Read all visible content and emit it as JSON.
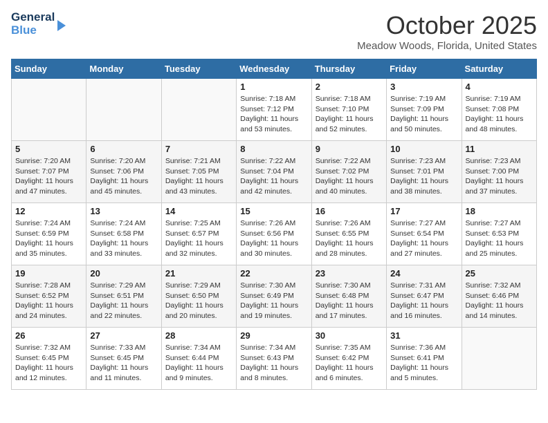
{
  "logo": {
    "line1": "General",
    "line2": "Blue"
  },
  "title": "October 2025",
  "location": "Meadow Woods, Florida, United States",
  "days_of_week": [
    "Sunday",
    "Monday",
    "Tuesday",
    "Wednesday",
    "Thursday",
    "Friday",
    "Saturday"
  ],
  "weeks": [
    [
      {
        "day": "",
        "info": ""
      },
      {
        "day": "",
        "info": ""
      },
      {
        "day": "",
        "info": ""
      },
      {
        "day": "1",
        "info": "Sunrise: 7:18 AM\nSunset: 7:12 PM\nDaylight: 11 hours\nand 53 minutes."
      },
      {
        "day": "2",
        "info": "Sunrise: 7:18 AM\nSunset: 7:10 PM\nDaylight: 11 hours\nand 52 minutes."
      },
      {
        "day": "3",
        "info": "Sunrise: 7:19 AM\nSunset: 7:09 PM\nDaylight: 11 hours\nand 50 minutes."
      },
      {
        "day": "4",
        "info": "Sunrise: 7:19 AM\nSunset: 7:08 PM\nDaylight: 11 hours\nand 48 minutes."
      }
    ],
    [
      {
        "day": "5",
        "info": "Sunrise: 7:20 AM\nSunset: 7:07 PM\nDaylight: 11 hours\nand 47 minutes."
      },
      {
        "day": "6",
        "info": "Sunrise: 7:20 AM\nSunset: 7:06 PM\nDaylight: 11 hours\nand 45 minutes."
      },
      {
        "day": "7",
        "info": "Sunrise: 7:21 AM\nSunset: 7:05 PM\nDaylight: 11 hours\nand 43 minutes."
      },
      {
        "day": "8",
        "info": "Sunrise: 7:22 AM\nSunset: 7:04 PM\nDaylight: 11 hours\nand 42 minutes."
      },
      {
        "day": "9",
        "info": "Sunrise: 7:22 AM\nSunset: 7:02 PM\nDaylight: 11 hours\nand 40 minutes."
      },
      {
        "day": "10",
        "info": "Sunrise: 7:23 AM\nSunset: 7:01 PM\nDaylight: 11 hours\nand 38 minutes."
      },
      {
        "day": "11",
        "info": "Sunrise: 7:23 AM\nSunset: 7:00 PM\nDaylight: 11 hours\nand 37 minutes."
      }
    ],
    [
      {
        "day": "12",
        "info": "Sunrise: 7:24 AM\nSunset: 6:59 PM\nDaylight: 11 hours\nand 35 minutes."
      },
      {
        "day": "13",
        "info": "Sunrise: 7:24 AM\nSunset: 6:58 PM\nDaylight: 11 hours\nand 33 minutes."
      },
      {
        "day": "14",
        "info": "Sunrise: 7:25 AM\nSunset: 6:57 PM\nDaylight: 11 hours\nand 32 minutes."
      },
      {
        "day": "15",
        "info": "Sunrise: 7:26 AM\nSunset: 6:56 PM\nDaylight: 11 hours\nand 30 minutes."
      },
      {
        "day": "16",
        "info": "Sunrise: 7:26 AM\nSunset: 6:55 PM\nDaylight: 11 hours\nand 28 minutes."
      },
      {
        "day": "17",
        "info": "Sunrise: 7:27 AM\nSunset: 6:54 PM\nDaylight: 11 hours\nand 27 minutes."
      },
      {
        "day": "18",
        "info": "Sunrise: 7:27 AM\nSunset: 6:53 PM\nDaylight: 11 hours\nand 25 minutes."
      }
    ],
    [
      {
        "day": "19",
        "info": "Sunrise: 7:28 AM\nSunset: 6:52 PM\nDaylight: 11 hours\nand 24 minutes."
      },
      {
        "day": "20",
        "info": "Sunrise: 7:29 AM\nSunset: 6:51 PM\nDaylight: 11 hours\nand 22 minutes."
      },
      {
        "day": "21",
        "info": "Sunrise: 7:29 AM\nSunset: 6:50 PM\nDaylight: 11 hours\nand 20 minutes."
      },
      {
        "day": "22",
        "info": "Sunrise: 7:30 AM\nSunset: 6:49 PM\nDaylight: 11 hours\nand 19 minutes."
      },
      {
        "day": "23",
        "info": "Sunrise: 7:30 AM\nSunset: 6:48 PM\nDaylight: 11 hours\nand 17 minutes."
      },
      {
        "day": "24",
        "info": "Sunrise: 7:31 AM\nSunset: 6:47 PM\nDaylight: 11 hours\nand 16 minutes."
      },
      {
        "day": "25",
        "info": "Sunrise: 7:32 AM\nSunset: 6:46 PM\nDaylight: 11 hours\nand 14 minutes."
      }
    ],
    [
      {
        "day": "26",
        "info": "Sunrise: 7:32 AM\nSunset: 6:45 PM\nDaylight: 11 hours\nand 12 minutes."
      },
      {
        "day": "27",
        "info": "Sunrise: 7:33 AM\nSunset: 6:45 PM\nDaylight: 11 hours\nand 11 minutes."
      },
      {
        "day": "28",
        "info": "Sunrise: 7:34 AM\nSunset: 6:44 PM\nDaylight: 11 hours\nand 9 minutes."
      },
      {
        "day": "29",
        "info": "Sunrise: 7:34 AM\nSunset: 6:43 PM\nDaylight: 11 hours\nand 8 minutes."
      },
      {
        "day": "30",
        "info": "Sunrise: 7:35 AM\nSunset: 6:42 PM\nDaylight: 11 hours\nand 6 minutes."
      },
      {
        "day": "31",
        "info": "Sunrise: 7:36 AM\nSunset: 6:41 PM\nDaylight: 11 hours\nand 5 minutes."
      },
      {
        "day": "",
        "info": ""
      }
    ]
  ]
}
